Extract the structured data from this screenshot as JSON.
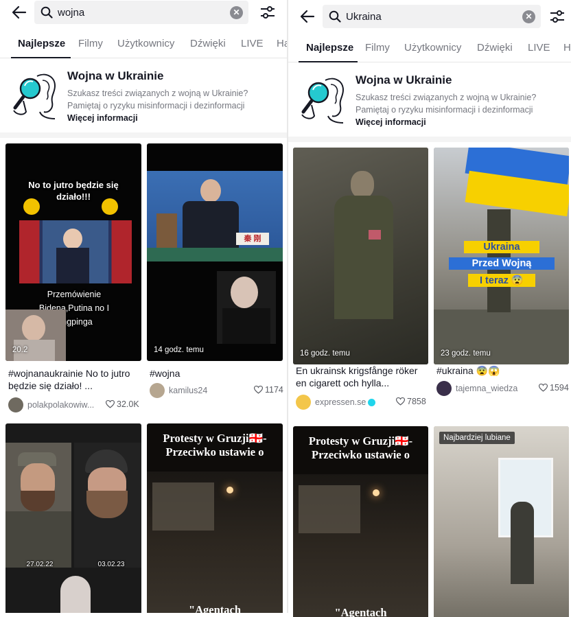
{
  "left": {
    "search": {
      "query": "wojna"
    },
    "tabs": [
      "Najlepsze",
      "Filmy",
      "Użytkownicy",
      "Dźwięki",
      "LIVE",
      "Ha"
    ],
    "info": {
      "title": "Wojna w Ukrainie",
      "body": "Szukasz treści związanych z wojną w Ukrainie? Pamiętaj o ryzyku misinformacji i dezinformacji",
      "more": "Więcej informacji"
    },
    "videos": [
      {
        "overlay_top": "No to jutro będzie się działo!!!",
        "overlay_bottom": "Przemówienie Bidena,Putina no I Jingpinga",
        "time": "20.2",
        "caption": "#wojnanaukrainie No to jutro będzie się działo! ...",
        "author": "polakpolakowiw...",
        "likes": "32.0K"
      },
      {
        "nameplate": "秦 刚",
        "time": "14 godz. temu",
        "caption": "#wojna",
        "author": "kamilus24",
        "likes": "1174"
      },
      {
        "date_left": "27.02.22",
        "date_right": "03.02.23"
      },
      {
        "overlay_title": "Protesty w Gruzji🇬🇪- Przeciwko ustawie o",
        "overlay_bottom": "\"Agentach"
      }
    ]
  },
  "right": {
    "search": {
      "query": "Ukraina"
    },
    "tabs": [
      "Najlepsze",
      "Filmy",
      "Użytkownicy",
      "Dźwięki",
      "LIVE",
      "H"
    ],
    "info": {
      "title": "Wojna w Ukrainie",
      "body": "Szukasz treści związanych z wojną w Ukrainie? Pamiętaj o ryzyku misinformacji i dezinformacji",
      "more": "Więcej informacji"
    },
    "videos": [
      {
        "time": "16 godz. temu",
        "caption": "En ukrainsk krigsfånge röker en cigarett och hylla...",
        "author": "expressen.se",
        "likes": "7858"
      },
      {
        "label1": "Ukraina",
        "label2": "Przed Wojną",
        "label3": "I teraz 😨",
        "time": "23 godz. temu",
        "caption": "#ukraina 😨😱",
        "author": "tajemna_wiedza",
        "likes": "1594"
      },
      {
        "overlay_title": "Protesty w Gruzji🇬🇪- Przeciwko ustawie o",
        "overlay_bottom": "\"Agentach"
      },
      {
        "badge": "Najbardziej lubiane"
      }
    ]
  },
  "colors": {
    "text": "#161823",
    "muted": "#75777f",
    "ukraine_blue": "#2c6fd6",
    "ukraine_yellow": "#f7d000"
  }
}
